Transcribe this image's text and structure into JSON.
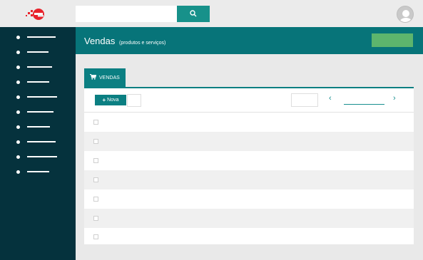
{
  "header": {
    "title": "Vendas",
    "subtitle": "(produtos e serviços)"
  },
  "tabs": [
    {
      "label": "VENDAS",
      "icon": "cart-icon",
      "active": true
    }
  ],
  "toolbar": {
    "new_label": "Nova"
  },
  "search": {
    "value": "",
    "placeholder": ""
  },
  "colors": {
    "sidebar": "#05323d",
    "header": "#077479",
    "accent": "#17918a",
    "primary_button": "#5db56d",
    "logo": "#e8232c"
  },
  "table": {
    "rows": 7
  }
}
